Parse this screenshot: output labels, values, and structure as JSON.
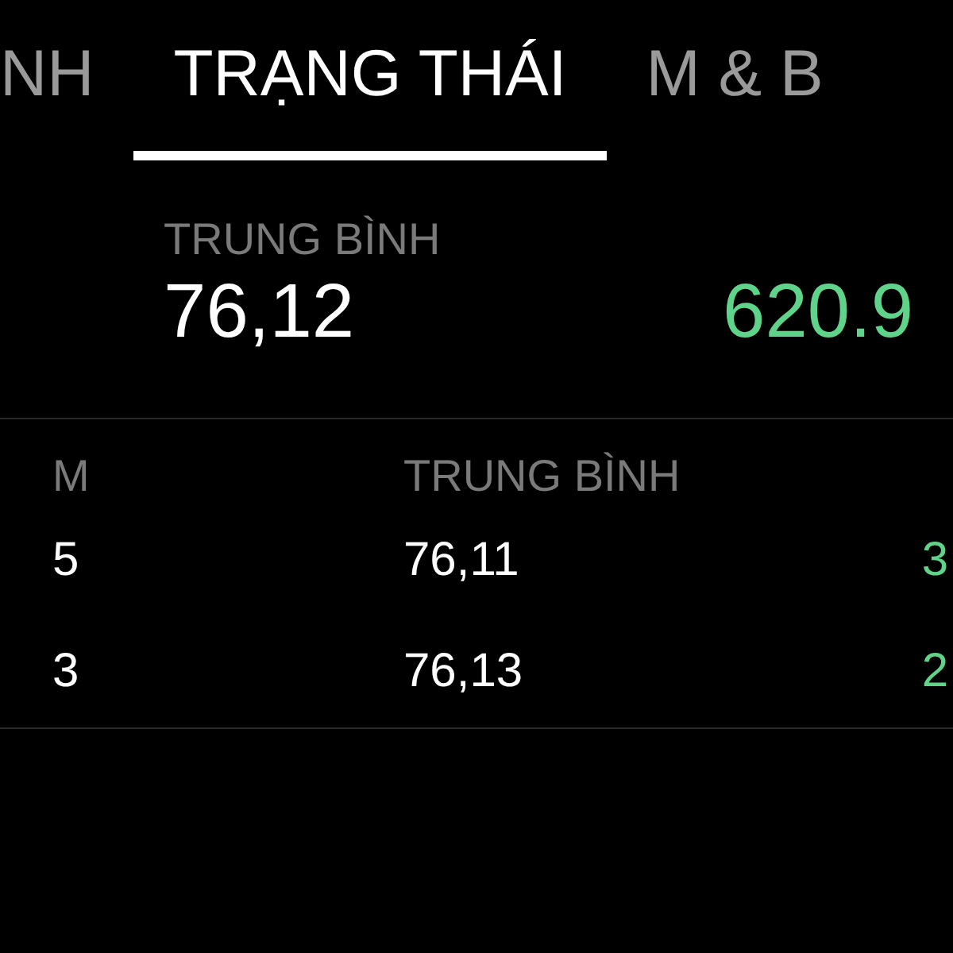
{
  "tabs": [
    {
      "label": "NH",
      "selected": false
    },
    {
      "label": "TRẠNG THÁI",
      "selected": true
    },
    {
      "label": "M & B",
      "selected": false
    }
  ],
  "summary": {
    "label": "TRUNG BÌNH",
    "value": "76,12",
    "column_2_value": "620.9"
  },
  "table": {
    "columns": [
      "M",
      "TRUNG BÌNH"
    ],
    "rows": [
      {
        "m": "5",
        "average": "76,11",
        "column_3": "3"
      },
      {
        "m": "3",
        "average": "76,13",
        "column_3": "2"
      }
    ]
  }
}
